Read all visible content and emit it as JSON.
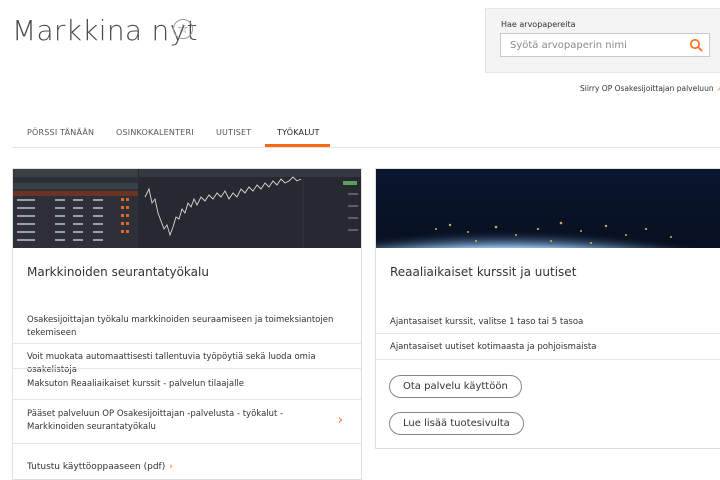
{
  "header": {
    "title": "Markkina nyt",
    "favorite_icon": "star-icon"
  },
  "search": {
    "label": "Hae arvopapereita",
    "placeholder": "Syötä arvopaperin nimi",
    "icon": "search-icon"
  },
  "service_link": {
    "label": "Siirry OP Osakesijoittajan palveluun",
    "icon": "external-link-icon"
  },
  "tabs": [
    {
      "label": "PÖRSSI TÄNÄÄN",
      "active": false
    },
    {
      "label": "OSINKOKALENTERI",
      "active": false
    },
    {
      "label": "UUTISET",
      "active": false
    },
    {
      "label": "TYÖKALUT",
      "active": true
    }
  ],
  "colors": {
    "accent": "#ff6a10",
    "text": "#333333",
    "border": "#e0e0e0"
  },
  "tool_card": {
    "title": "Markkinoiden seurantatyökalu",
    "description": "Osakesijoittajan työkalu markkinoiden seuraamiseen ja toimeksiantojen tekemiseen",
    "features": [
      "Voit muokata automaattisesti tallentuvia työpöytiä sekä luoda omia osakelistoja",
      "Maksuton Reaaliaikaiset kurssit - palvelun tilaajalle"
    ],
    "access_link": "Pääset palveluun OP Osakesijoittajan -palvelusta - työkalut - Markkinoiden seurantatyökalu",
    "guide_link": "Tutustu käyttöoppaaseen (pdf)"
  },
  "realtime_card": {
    "title": "Reaaliaikaiset kurssit ja uutiset",
    "features": [
      "Ajantasaiset kurssit, valitse 1 taso tai 5 tasoa",
      "Ajantasaiset uutiset kotimaasta ja pohjoismaista"
    ],
    "button_primary": "Ota palvelu käyttöön",
    "button_secondary": "Lue lisää tuotesivulta"
  }
}
